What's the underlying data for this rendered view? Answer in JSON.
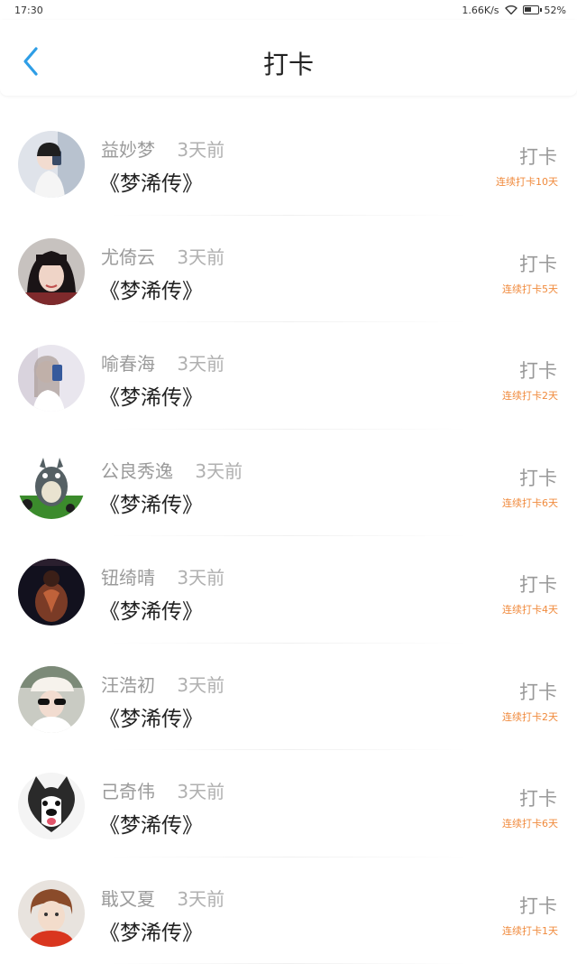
{
  "status_bar": {
    "time": "17:30",
    "network_speed": "1.66K/s",
    "battery": "52%"
  },
  "header": {
    "title": "打卡",
    "back_icon": "chevron-left-icon",
    "accent_color": "#2e9ee6"
  },
  "entries": [
    {
      "name": "益妙梦",
      "time": "3天前",
      "book": "《梦浠传》",
      "action": "打卡",
      "streak": "连续打卡10天",
      "avatar": "photo-avatar"
    },
    {
      "name": "尤倚云",
      "time": "3天前",
      "book": "《梦浠传》",
      "action": "打卡",
      "streak": "连续打卡5天",
      "avatar": "photo-avatar"
    },
    {
      "name": "喻春海",
      "time": "3天前",
      "book": "《梦浠传》",
      "action": "打卡",
      "streak": "连续打卡2天",
      "avatar": "photo-avatar"
    },
    {
      "name": "公良秀逸",
      "time": "3天前",
      "book": "《梦浠传》",
      "action": "打卡",
      "streak": "连续打卡6天",
      "avatar": "totoro-avatar"
    },
    {
      "name": "钮绮晴",
      "time": "3天前",
      "book": "《梦浠传》",
      "action": "打卡",
      "streak": "连续打卡4天",
      "avatar": "photo-avatar"
    },
    {
      "name": "汪浩初",
      "time": "3天前",
      "book": "《梦浠传》",
      "action": "打卡",
      "streak": "连续打卡2天",
      "avatar": "photo-avatar"
    },
    {
      "name": "己奇伟",
      "time": "3天前",
      "book": "《梦浠传》",
      "action": "打卡",
      "streak": "连续打卡6天",
      "avatar": "dog-avatar"
    },
    {
      "name": "戢又夏",
      "time": "3天前",
      "book": "《梦浠传》",
      "action": "打卡",
      "streak": "连续打卡1天",
      "avatar": "photo-avatar"
    }
  ],
  "colors": {
    "streak": "#f08a3c",
    "name": "#9a9a9a",
    "book": "#222222"
  }
}
